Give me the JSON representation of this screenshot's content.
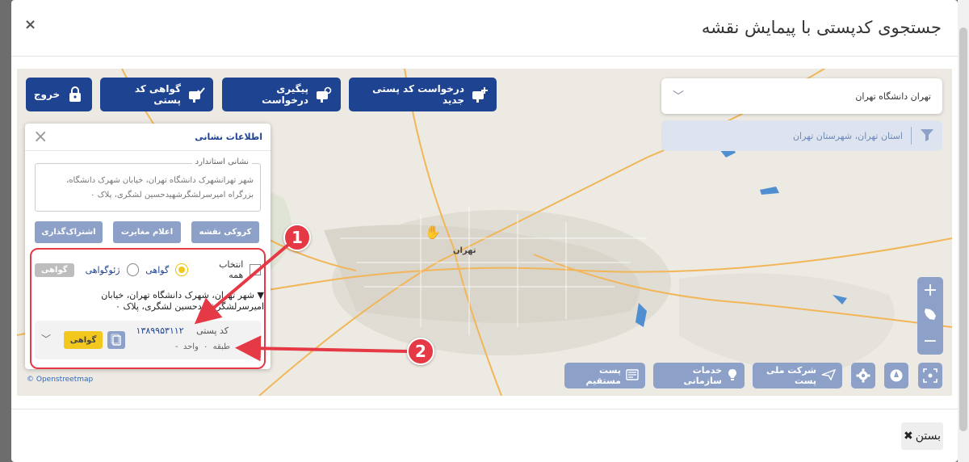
{
  "modal": {
    "title": "جستجوی کدپستی با پیمایش نقشه",
    "close_x": "×",
    "footer_close": "بستن",
    "footer_close_icon": "✖"
  },
  "toolbar": {
    "new_request": "درخواست کد پستی جدید",
    "track_request": "پیگیری درخواست",
    "postal_certificate": "گواهی کد پستی",
    "exit": "خروج"
  },
  "search": {
    "value": "تهران دانشگاه تهران",
    "filter": "استان تهران، شهرستان تهران"
  },
  "panel": {
    "title": "اطلاعات نشانی",
    "standard_address_label": "نشانی استاندارد",
    "standard_address": "شهر تهرانشهرک دانشگاه تهران، خیابان شهرک دانشگاه، بزرگراه امیرسرلشگرشهیدحسین لشگری، پلاک ۰",
    "btn_map_sketch": "کروکی نقشه",
    "btn_report_mismatch": "اعلام مغایرت",
    "btn_share": "اشتراک‌گذاری",
    "select_all": "انتخاب همه",
    "opt_certificate": "گواهی",
    "opt_geo_certificate": "ژئوگواهی",
    "tag_certificate": "گواهی",
    "address_item": "شهر تهران، شهرک دانشگاه تهران، خیابان امیرسرلشگرشهیدحسین لشگری، پلاک ۰",
    "postal_code_label": "کد پستی",
    "postal_code": "۱۳۸۹۹۵۳۱۱۲",
    "floor_unit": "طبقه ۰   واحد -",
    "tag_yellow": "گواهی"
  },
  "map": {
    "city_label": "تهران",
    "attribution": "© Openstreetmap",
    "bottom_buttons": {
      "national_post": "شرکت ملی پست",
      "org_services": "خدمات سازمانی",
      "direct_post": "پست مستقیم"
    },
    "badges": [
      "1",
      "2"
    ],
    "zoom_in": "+",
    "zoom_out": "−"
  },
  "colors": {
    "primary": "#1e4390",
    "muted_button": "#8da0c7",
    "accent_yellow": "#f2c81e",
    "highlight_red": "#e53945"
  }
}
